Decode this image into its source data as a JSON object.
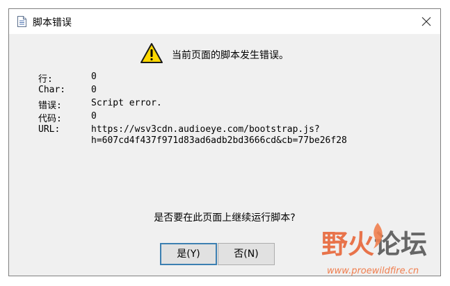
{
  "dialog": {
    "title": "脚本错误",
    "close_icon": "close-icon",
    "colors": {
      "body_bg": "#f0f0f0",
      "titlebar_bg": "#ffffff",
      "warning_yellow": "#ffd800",
      "button_bg": "#e1e1e1",
      "default_button_border": "#3c7fb1"
    }
  },
  "warning": {
    "icon": "warning-icon",
    "message": "当前页面的脚本发生错误。"
  },
  "details": {
    "line_label": "行:",
    "line_value": "0",
    "char_label": "Char:",
    "char_value": "0",
    "error_label": "错误:",
    "error_value": "Script error.",
    "code_label": "代码:",
    "code_value": "0",
    "url_label": "URL:",
    "url_value_line1": "https://wsv3cdn.audioeye.com/bootstrap.js?",
    "url_value_line2": "h=607cd4f437f971d83ad6adb2bd3666cd&cb=77be26f28"
  },
  "question": "是否要在此页面上继续运行脚本?",
  "buttons": {
    "yes_label": "是(Y)",
    "no_label": "否(N)"
  },
  "watermark": {
    "part1": "野火",
    "part2": "论坛",
    "url": "www.proewildfire.cn"
  }
}
